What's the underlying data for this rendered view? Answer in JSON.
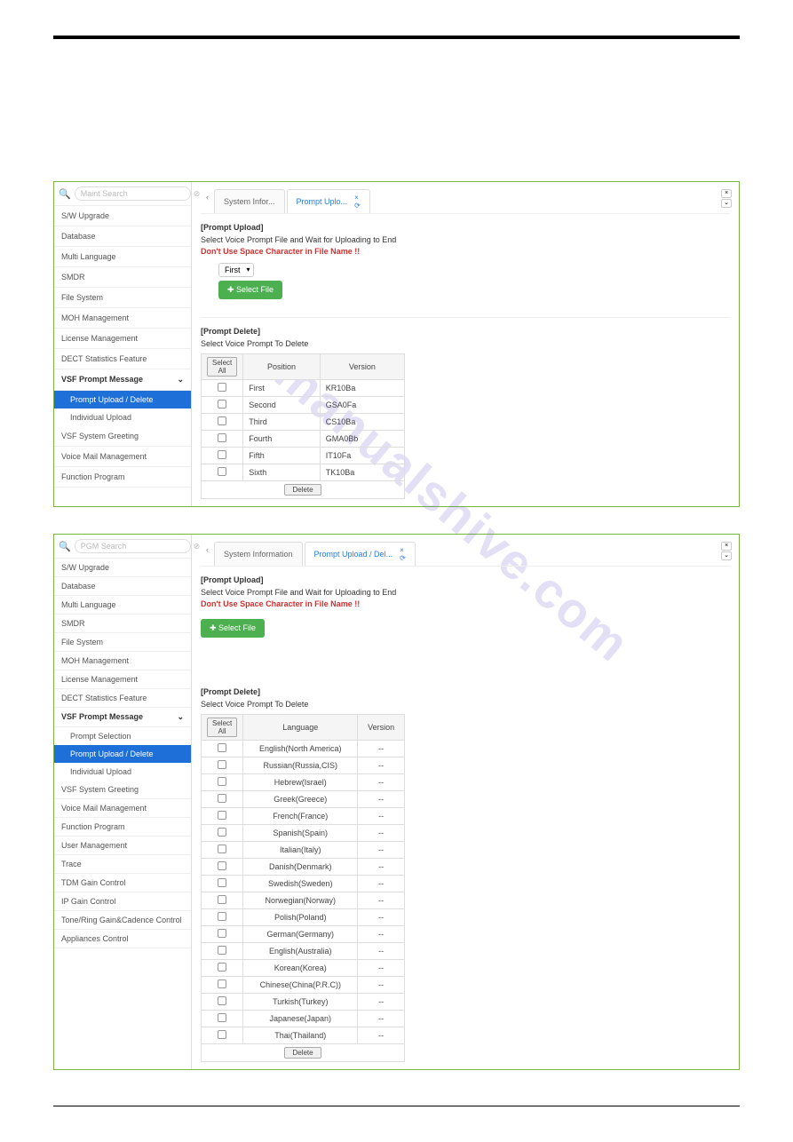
{
  "shot1": {
    "searchPlaceholder": "Maint Search",
    "sidebar": [
      "S/W Upgrade",
      "Database",
      "Multi Language",
      "SMDR",
      "File System",
      "MOH Management",
      "License Management",
      "DECT Statistics Feature"
    ],
    "sidebarHeader": "VSF Prompt Message",
    "sidebarSubs": [
      {
        "label": "Prompt Upload / Delete",
        "active": true
      },
      {
        "label": "Individual Upload",
        "active": false
      }
    ],
    "sidebarAfter": [
      "VSF System Greeting",
      "Voice Mail Management",
      "Function Program"
    ],
    "tabs": [
      {
        "label": "System Infor...",
        "active": false
      },
      {
        "label": "Prompt Uplo...",
        "active": true
      }
    ],
    "uploadTitle": "[Prompt Upload]",
    "uploadInstr": "Select Voice Prompt File and Wait for Uploading to End",
    "uploadWarn": "Don't Use Space Character in File Name !!",
    "dropdownValue": "First",
    "selectFileLabel": "Select File",
    "deleteTitle": "[Prompt Delete]",
    "deleteInstr": "Select Voice Prompt To Delete",
    "selectAllLabel": "Select All",
    "tableHeaders": [
      "Position",
      "Version"
    ],
    "rows": [
      {
        "position": "First",
        "version": "KR10Ba"
      },
      {
        "position": "Second",
        "version": "GSA0Fa"
      },
      {
        "position": "Third",
        "version": "CS10Ba"
      },
      {
        "position": "Fourth",
        "version": "GMA0Bb"
      },
      {
        "position": "Fifth",
        "version": "IT10Fa"
      },
      {
        "position": "Sixth",
        "version": "TK10Ba"
      }
    ],
    "deleteBtn": "Delete"
  },
  "shot2": {
    "searchPlaceholder": "PGM Search",
    "sidebar": [
      "S/W Upgrade",
      "Database",
      "Multi Language",
      "SMDR",
      "File System",
      "MOH Management",
      "License Management",
      "DECT Statistics Feature"
    ],
    "sidebarHeader": "VSF Prompt Message",
    "sidebarSubs": [
      {
        "label": "Prompt Selection",
        "active": false
      },
      {
        "label": "Prompt Upload / Delete",
        "active": true
      },
      {
        "label": "Individual Upload",
        "active": false
      }
    ],
    "sidebarAfter": [
      "VSF System Greeting",
      "Voice Mail Management",
      "Function Program",
      "User Management",
      "Trace",
      "TDM Gain Control",
      "IP Gain Control",
      "Tone/Ring Gain&Cadence Control",
      "Appliances Control"
    ],
    "tabs": [
      {
        "label": "System Information",
        "active": false
      },
      {
        "label": "Prompt Upload / Del...",
        "active": true
      }
    ],
    "uploadTitle": "[Prompt Upload]",
    "uploadInstr": "Select Voice Prompt File and Wait for Uploading to End",
    "uploadWarn": "Don't Use Space Character in File Name !!",
    "selectFileLabel": "Select File",
    "deleteTitle": "[Prompt Delete]",
    "deleteInstr": "Select Voice Prompt To Delete",
    "selectAllLabel": "Select All",
    "tableHeaders": [
      "Language",
      "Version"
    ],
    "rows": [
      {
        "language": "English(North America)",
        "version": "--"
      },
      {
        "language": "Russian(Russia,CIS)",
        "version": "--"
      },
      {
        "language": "Hebrew(Israel)",
        "version": "--"
      },
      {
        "language": "Greek(Greece)",
        "version": "--"
      },
      {
        "language": "French(France)",
        "version": "--"
      },
      {
        "language": "Spanish(Spain)",
        "version": "--"
      },
      {
        "language": "Italian(Italy)",
        "version": "--"
      },
      {
        "language": "Danish(Denmark)",
        "version": "--"
      },
      {
        "language": "Swedish(Sweden)",
        "version": "--"
      },
      {
        "language": "Norwegian(Norway)",
        "version": "--"
      },
      {
        "language": "Polish(Poland)",
        "version": "--"
      },
      {
        "language": "German(Germany)",
        "version": "--"
      },
      {
        "language": "English(Australia)",
        "version": "--"
      },
      {
        "language": "Korean(Korea)",
        "version": "--"
      },
      {
        "language": "Chinese(China(P.R.C))",
        "version": "--"
      },
      {
        "language": "Turkish(Turkey)",
        "version": "--"
      },
      {
        "language": "Japanese(Japan)",
        "version": "--"
      },
      {
        "language": "Thai(Thailand)",
        "version": "--"
      }
    ],
    "deleteBtn": "Delete"
  },
  "watermark": "manualshive.com"
}
